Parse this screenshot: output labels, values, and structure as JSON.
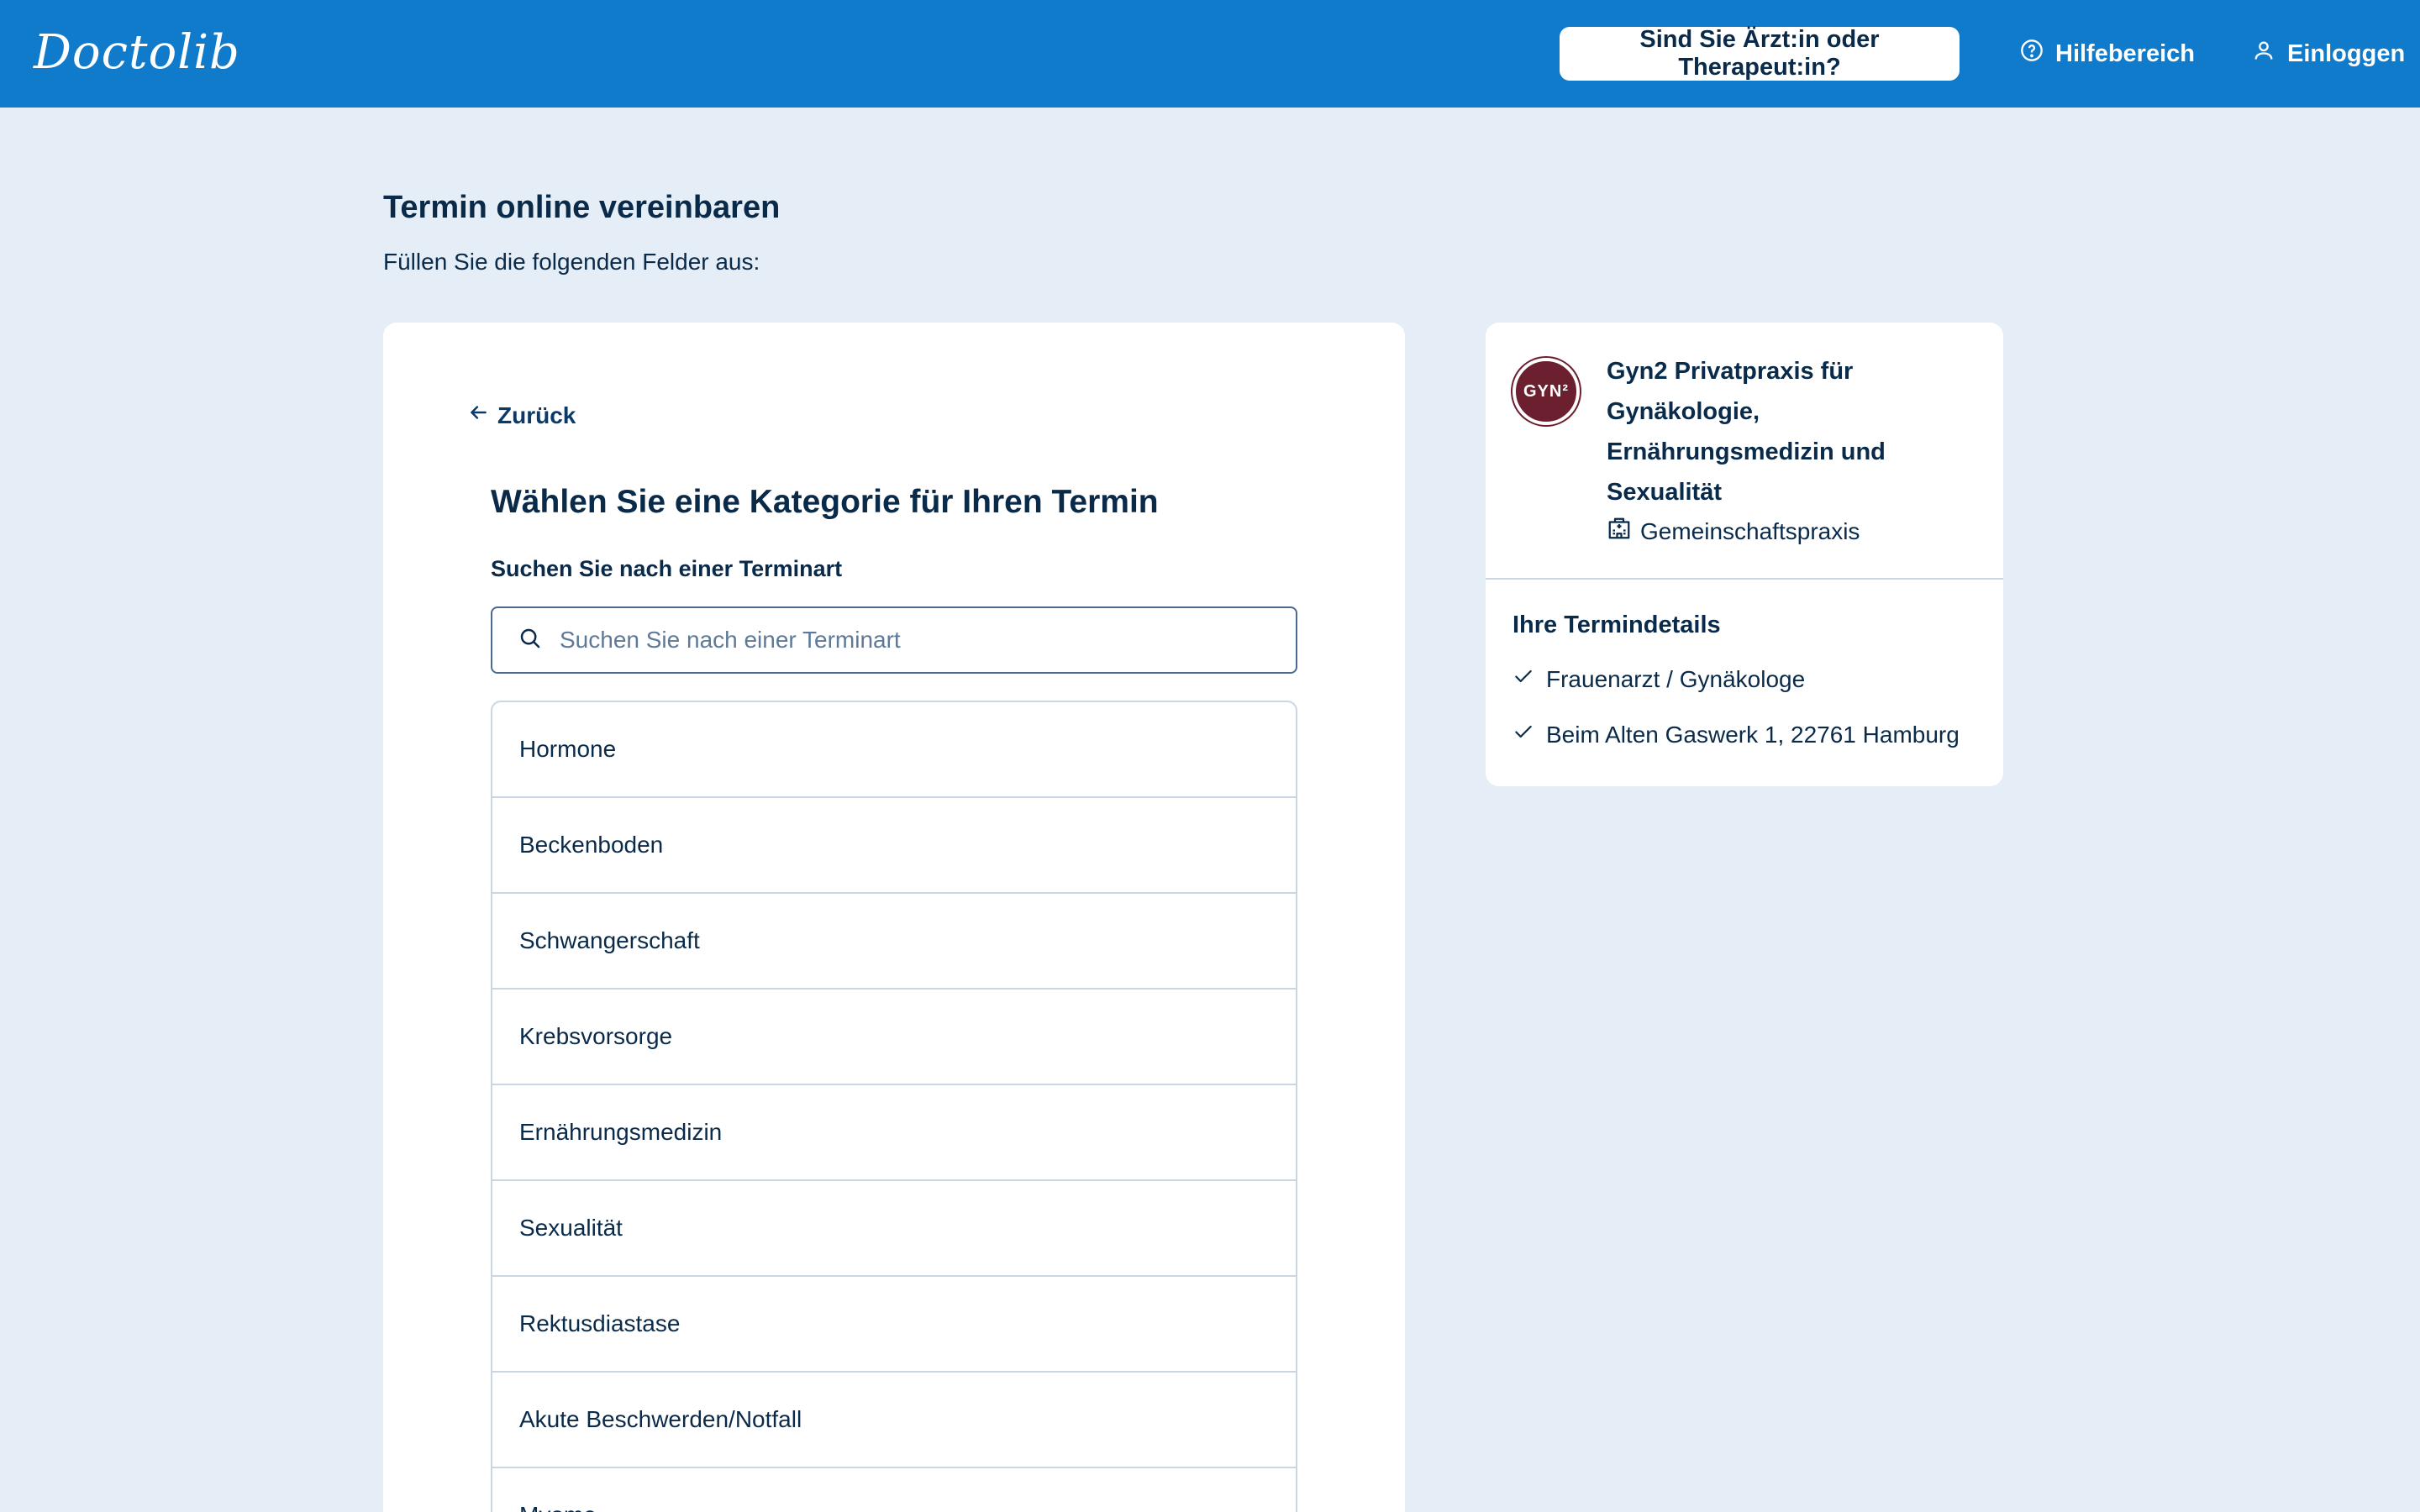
{
  "header": {
    "logo": "Doctolib",
    "pro_button": "Sind Sie Ärzt:in oder Therapeut:in?",
    "help": "Hilfebereich",
    "login": "Einloggen"
  },
  "page": {
    "title": "Termin online vereinbaren",
    "subtitle": "Füllen Sie die folgenden Felder aus:"
  },
  "main": {
    "back": "Zurück",
    "title": "Wählen Sie eine Kategorie für Ihren Termin",
    "search_label": "Suchen Sie nach einer Terminart",
    "search_placeholder": "Suchen Sie nach einer Terminart",
    "categories": [
      "Hormone",
      "Beckenboden",
      "Schwangerschaft",
      "Krebsvorsorge",
      "Ernährungsmedizin",
      "Sexualität",
      "Rektusdiastase",
      "Akute Beschwerden/Notfall",
      "Myome"
    ]
  },
  "side": {
    "avatar_text": "GYN²",
    "practice_name": "Gyn2 Privatpraxis für Gynäkologie, Ernährungsmedizin und Sexualität",
    "practice_type": "Gemeinschaftspraxis",
    "details_title": "Ihre Termindetails",
    "detail_specialty": "Frauenarzt / Gynäkologe",
    "detail_address": "Beim Alten Gaswerk 1, 22761 Hamburg"
  },
  "colors": {
    "brand": "#107acb",
    "background": "#e5edf6",
    "text": "#0a2a4a",
    "avatar": "#6b1f2f"
  }
}
